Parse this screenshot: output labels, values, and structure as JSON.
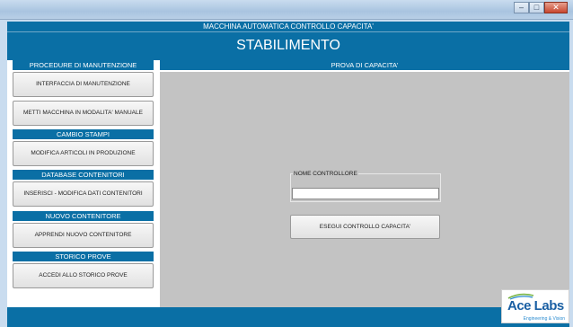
{
  "window": {
    "minimize_glyph": "–",
    "maximize_glyph": "□",
    "close_glyph": "✕"
  },
  "header": {
    "app_title": "MACCHINA AUTOMATICA CONTROLLO CAPACITA'",
    "location": "STABILIMENTO"
  },
  "sidebar": {
    "sections": [
      {
        "title": "PROCEDURE DI MANUTENZIONE",
        "buttons": [
          "INTERFACCIA DI MANUTENZIONE",
          "METTI MACCHINA IN MODALITA' MANUALE"
        ]
      },
      {
        "title": "CAMBIO STAMPI",
        "buttons": [
          "MODIFICA ARTICOLI IN PRODUZIONE"
        ]
      },
      {
        "title": "DATABASE CONTENITORI",
        "buttons": [
          "INSERISCI - MODIFICA DATI CONTENITORI"
        ]
      },
      {
        "title": "NUOVO CONTENITORE",
        "buttons": [
          "APPRENDI NUOVO CONTENITORE"
        ]
      },
      {
        "title": "STORICO PROVE",
        "buttons": [
          "ACCEDI ALLO STORICO PROVE"
        ]
      }
    ]
  },
  "main": {
    "panel_title": "PROVA DI CAPACITA'",
    "controller_field": {
      "label": "NOME CONTROLLORE",
      "value": "",
      "placeholder": ""
    },
    "run_button": "ESEGUI CONTROLLO CAPACITA'"
  },
  "footer": {
    "logo_text": "Ace Labs",
    "logo_subtext": "Engineering & Vision"
  },
  "colors": {
    "primary": "#0a6fa5",
    "panel_gray": "#c3c3c3",
    "button_bg": "#eeeeee"
  }
}
